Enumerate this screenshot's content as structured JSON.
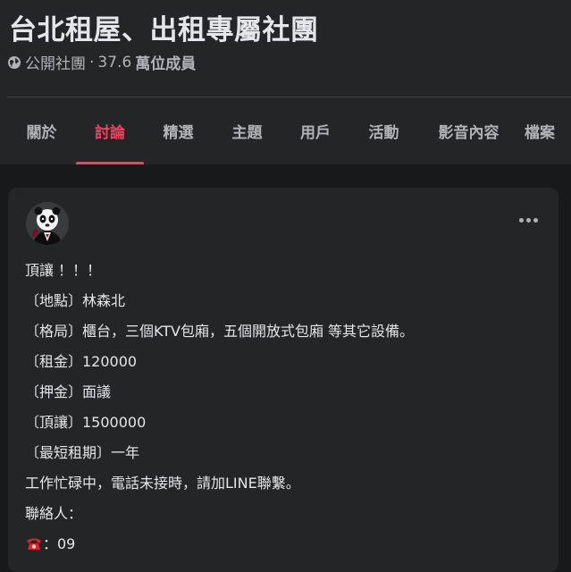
{
  "group": {
    "title": "台北租屋、出租專屬社團",
    "privacy": "公開社團",
    "separator": "·",
    "member_count": "37.6",
    "member_unit": "萬位成員"
  },
  "tabs": [
    {
      "label": "關於",
      "active": false
    },
    {
      "label": "討論",
      "active": true
    },
    {
      "label": "精選",
      "active": false
    },
    {
      "label": "主題",
      "active": false
    },
    {
      "label": "用戶",
      "active": false
    },
    {
      "label": "活動",
      "active": false
    },
    {
      "label": "影音內容",
      "active": false
    },
    {
      "label": "檔案",
      "active": false
    }
  ],
  "post": {
    "lines": [
      "頂讓 ！！！",
      "〔地點〕林森北",
      "〔格局〕櫃台，三個KTV包廂，五個開放式包廂 等其它設備。",
      "〔租金〕120000",
      "〔押金〕面議",
      "〔頂讓〕1500000",
      "〔最短租期〕一年",
      "工作忙碌中，電話未接時，請加LINE聯繫。",
      "聯絡人："
    ],
    "phone_icon": "☎",
    "phone_text": "：09"
  },
  "colors": {
    "accent": "#f3425f",
    "background": "#18191a",
    "card": "#242526",
    "text_primary": "#e4e6eb",
    "text_secondary": "#b0b3b8"
  }
}
